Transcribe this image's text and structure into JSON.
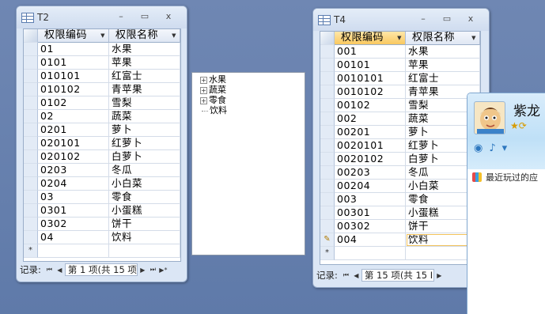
{
  "t2": {
    "title": "T2",
    "buttons": {
      "minimize": "–",
      "maximize": "▭",
      "close": "x"
    },
    "columns": [
      "权限编码",
      "权限名称"
    ],
    "rows": [
      [
        "01",
        "水果"
      ],
      [
        "0101",
        "苹果"
      ],
      [
        "010101",
        "红富士"
      ],
      [
        "010102",
        "青苹果"
      ],
      [
        "0102",
        "雪梨"
      ],
      [
        "02",
        "蔬菜"
      ],
      [
        "0201",
        "萝卜"
      ],
      [
        "020101",
        "红萝卜"
      ],
      [
        "020102",
        "白萝卜"
      ],
      [
        "0203",
        "冬瓜"
      ],
      [
        "0204",
        "小白菜"
      ],
      [
        "03",
        "零食"
      ],
      [
        "0301",
        "小蛋糕"
      ],
      [
        "0302",
        "饼干"
      ],
      [
        "04",
        "饮料"
      ]
    ],
    "new_row_marker": "*",
    "nav": {
      "label": "记录:",
      "first": "⏮",
      "prev": "◀",
      "record": "第 1 项(共 15 项",
      "next": "▶",
      "last": "⏭",
      "new": "▶*"
    }
  },
  "tree": {
    "items": [
      {
        "label": "水果",
        "expander": "+"
      },
      {
        "label": "蔬菜",
        "expander": "+"
      },
      {
        "label": "零食",
        "expander": "+"
      },
      {
        "label": "饮料",
        "expander": ""
      }
    ]
  },
  "t4": {
    "title": "T4",
    "buttons": {
      "minimize": "–",
      "maximize": "▭",
      "close": "x"
    },
    "columns": [
      "权限编码",
      "权限名称"
    ],
    "rows": [
      [
        "001",
        "水果"
      ],
      [
        "00101",
        "苹果"
      ],
      [
        "0010101",
        "红富士"
      ],
      [
        "0010102",
        "青苹果"
      ],
      [
        "00102",
        "雪梨"
      ],
      [
        "002",
        "蔬菜"
      ],
      [
        "00201",
        "萝卜"
      ],
      [
        "0020101",
        "红萝卜"
      ],
      [
        "0020102",
        "白萝卜"
      ],
      [
        "00203",
        "冬瓜"
      ],
      [
        "00204",
        "小白菜"
      ],
      [
        "003",
        "零食"
      ],
      [
        "00301",
        "小蛋糕"
      ],
      [
        "00302",
        "饼干"
      ],
      [
        "004",
        "饮料"
      ]
    ],
    "edit_marker": "✎",
    "new_row_marker": "*",
    "nav": {
      "label": "记录:",
      "first": "⏮",
      "prev": "◀",
      "record": "第 15 项(共 15 I",
      "next": "▶"
    }
  },
  "qq": {
    "name": "紫龙",
    "status_icons": "★⟳",
    "tools": [
      "◉",
      "♪",
      "▾"
    ],
    "recent_label": "最近玩过的应"
  }
}
